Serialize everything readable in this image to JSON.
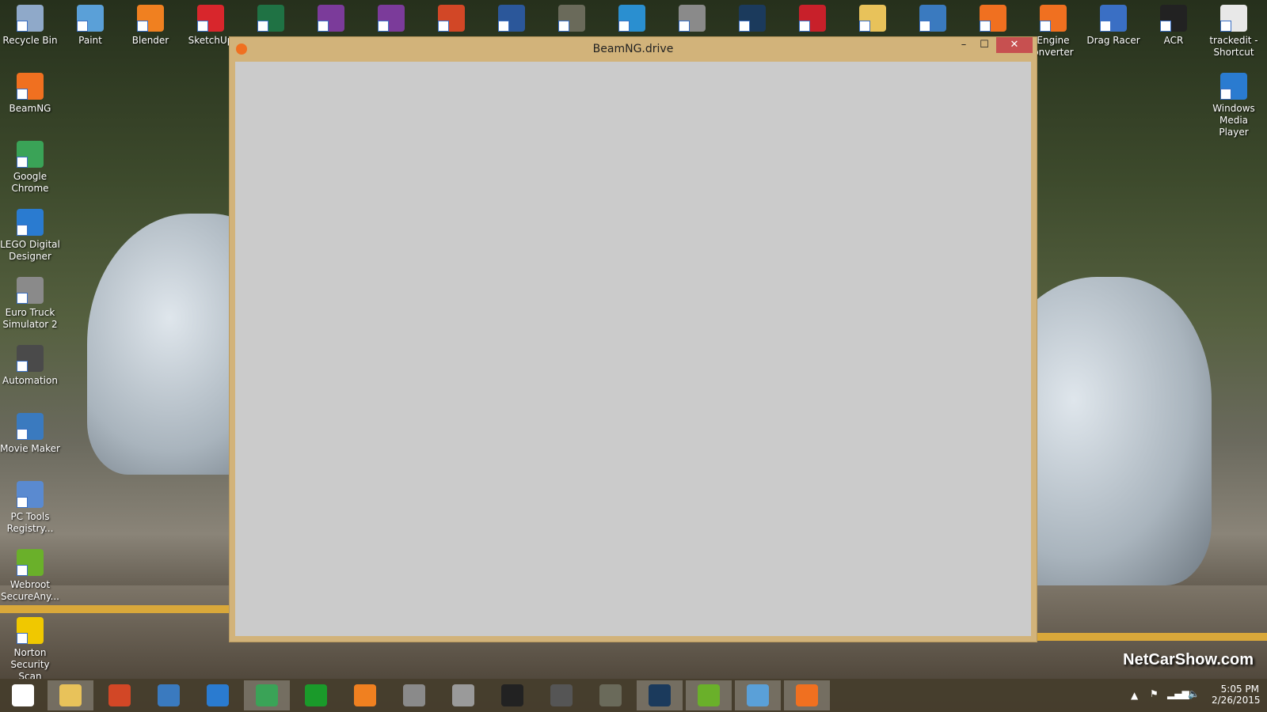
{
  "desktop": {
    "top_icons": [
      {
        "label": "Recycle Bin",
        "color": "#8fa9c9"
      },
      {
        "label": "Paint",
        "color": "#5aa0d8"
      },
      {
        "label": "Blender",
        "color": "#f08020"
      },
      {
        "label": "SketchUp",
        "color": "#d8262c"
      },
      {
        "label": "",
        "color": "#1f7244"
      },
      {
        "label": "",
        "color": "#7b3b9a"
      },
      {
        "label": "",
        "color": "#7b3b9a"
      },
      {
        "label": "",
        "color": "#d24726"
      },
      {
        "label": "",
        "color": "#2b579a"
      },
      {
        "label": "",
        "color": "#6a6a5a"
      },
      {
        "label": "",
        "color": "#2a8fd0"
      },
      {
        "label": "",
        "color": "#8a8a8a"
      },
      {
        "label": "",
        "color": "#1b3a5c"
      },
      {
        "label": "",
        "color": "#c8202a"
      },
      {
        "label": "",
        "color": "#e8c25a"
      },
      {
        "label": "",
        "color": "#3a7abf"
      },
      {
        "label": "",
        "color": "#f07020"
      },
      {
        "label": "Engine onverter",
        "color": "#f07020"
      },
      {
        "label": "Drag Racer",
        "color": "#3a6fc4"
      },
      {
        "label": "ACR",
        "color": "#222222"
      },
      {
        "label": "trackedit - Shortcut",
        "color": "#e8e8e8"
      }
    ],
    "left_icons": [
      {
        "label": "BeamNG",
        "color": "#f07020"
      },
      {
        "label": "Google Chrome",
        "color": "#3aa357"
      },
      {
        "label": "LEGO Digital Designer",
        "color": "#2a7bd0"
      },
      {
        "label": "Euro Truck Simulator 2",
        "color": "#8a8a8a"
      },
      {
        "label": "Automation",
        "color": "#4a4a4a"
      },
      {
        "label": "Movie Maker",
        "color": "#3a7abf"
      },
      {
        "label": "PC Tools Registry...",
        "color": "#5a8ad0"
      },
      {
        "label": "Webroot SecureAny...",
        "color": "#6ab02a"
      },
      {
        "label": "Norton Security Scan",
        "color": "#f0c800"
      }
    ],
    "right_icons": [
      {
        "label": "Windows Media Player",
        "color": "#2a7bd0"
      }
    ],
    "watermark": "NetCarShow.com"
  },
  "window": {
    "title": "BeamNG.drive",
    "minimize": "–",
    "maximize": "☐",
    "close": "✕",
    "accent": "#d2b37a",
    "close_color": "#c75050"
  },
  "taskbar": {
    "items": [
      {
        "name": "start",
        "color": "#ffffff"
      },
      {
        "name": "file-explorer",
        "color": "#e8c25a"
      },
      {
        "name": "paint",
        "color": "#d24726"
      },
      {
        "name": "movie-maker",
        "color": "#3a7abf"
      },
      {
        "name": "lego",
        "color": "#2a7bd0"
      },
      {
        "name": "chrome",
        "color": "#3aa357"
      },
      {
        "name": "store",
        "color": "#1a9a2a"
      },
      {
        "name": "media",
        "color": "#f08020"
      },
      {
        "name": "ets",
        "color": "#8a8a8a"
      },
      {
        "name": "truck",
        "color": "#9a9a9a"
      },
      {
        "name": "acr",
        "color": "#222222"
      },
      {
        "name": "automation",
        "color": "#555555"
      },
      {
        "name": "gimp",
        "color": "#6a6a5a"
      },
      {
        "name": "steam",
        "color": "#1b3a5c"
      },
      {
        "name": "webroot",
        "color": "#6ab02a"
      },
      {
        "name": "paint2",
        "color": "#5aa0d8"
      },
      {
        "name": "beamng",
        "color": "#f07020"
      }
    ],
    "time": "5:05 PM",
    "date": "2/26/2015"
  }
}
